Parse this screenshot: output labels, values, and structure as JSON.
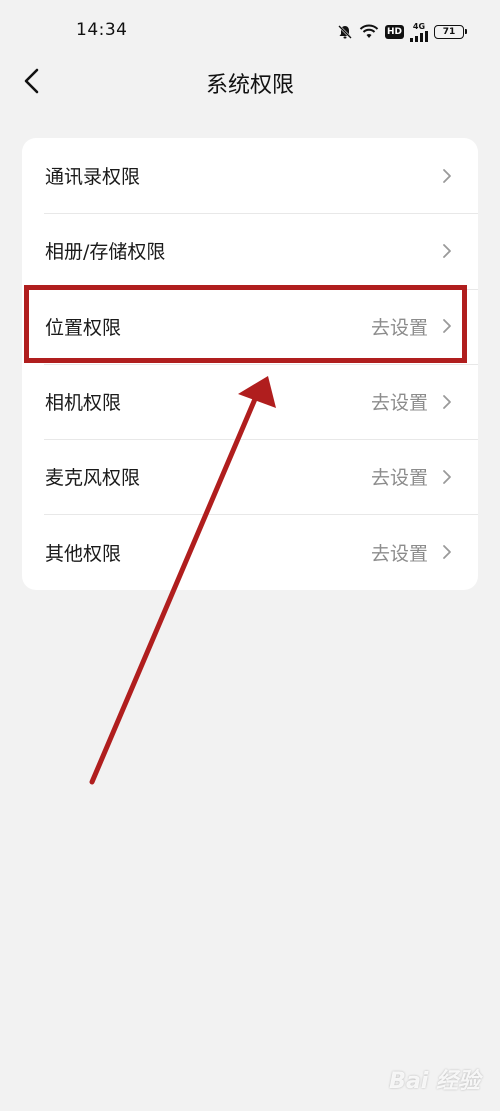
{
  "status_bar": {
    "time": "14:34",
    "network": "4G",
    "hd": "HD",
    "battery": "71",
    "icons": [
      "bell-muted-icon",
      "wifi-icon",
      "hd-icon",
      "signal-4g-icon",
      "battery-icon"
    ]
  },
  "header": {
    "title": "系统权限",
    "back_icon": "chevron-left-icon"
  },
  "permissions": {
    "items": [
      {
        "label": "通讯录权限",
        "value": ""
      },
      {
        "label": "相册/存储权限",
        "value": ""
      },
      {
        "label": "位置权限",
        "value": "去设置"
      },
      {
        "label": "相机权限",
        "value": "去设置"
      },
      {
        "label": "麦克风权限",
        "value": "去设置"
      },
      {
        "label": "其他权限",
        "value": "去设置"
      }
    ]
  },
  "annotation": {
    "color": "#b01e1e",
    "highlighted_item": "位置权限"
  },
  "watermark": {
    "text": "Bai 经验"
  },
  "colors": {
    "background": "#f2f2f2",
    "card": "#ffffff",
    "text_primary": "#1a1a1a",
    "text_secondary": "#8c8c8c",
    "annotation": "#b01e1e"
  }
}
